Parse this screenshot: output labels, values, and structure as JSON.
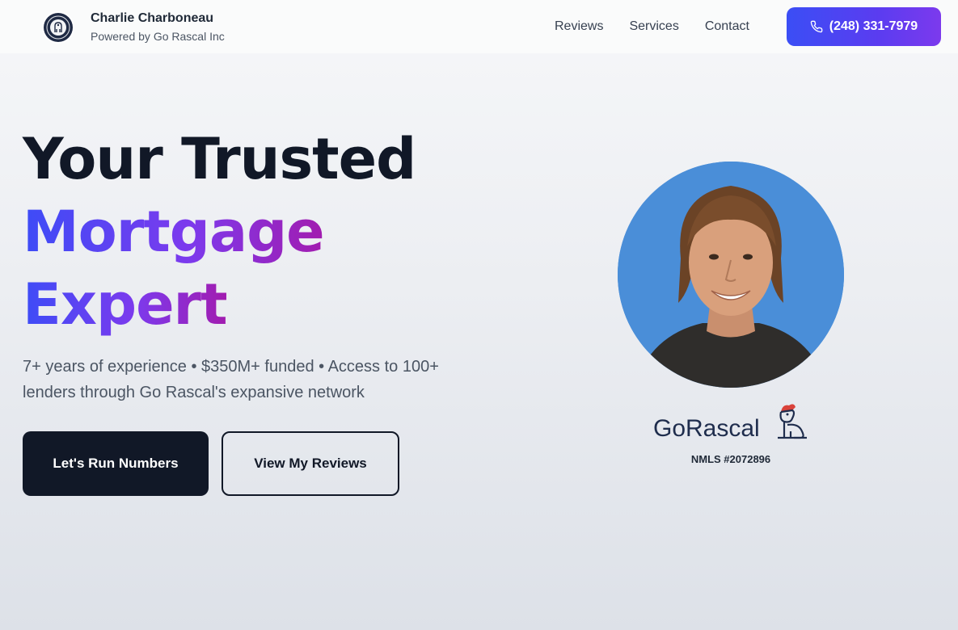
{
  "brand": {
    "name": "Charlie Charboneau",
    "tagline": "Powered by Go Rascal Inc"
  },
  "nav": {
    "items": [
      "Reviews",
      "Services",
      "Contact"
    ],
    "phone": "(248) 331-7979"
  },
  "hero": {
    "title_line1": "Your Trusted",
    "title_line2": "Mortgage",
    "title_line3": "Expert",
    "subtitle": "7+ years of experience • $350M+ funded • Access to 100+ lenders through Go Rascal's expansive network",
    "primary_cta": "Let's Run Numbers",
    "secondary_cta": "View My Reviews"
  },
  "profile": {
    "logo_text": "GoRascal",
    "nmls": "NMLS #2072896"
  },
  "colors": {
    "accent_start": "#3b4ef5",
    "accent_end": "#7c3aed",
    "dark": "#111827",
    "portrait_bg": "#4a8ed8"
  }
}
